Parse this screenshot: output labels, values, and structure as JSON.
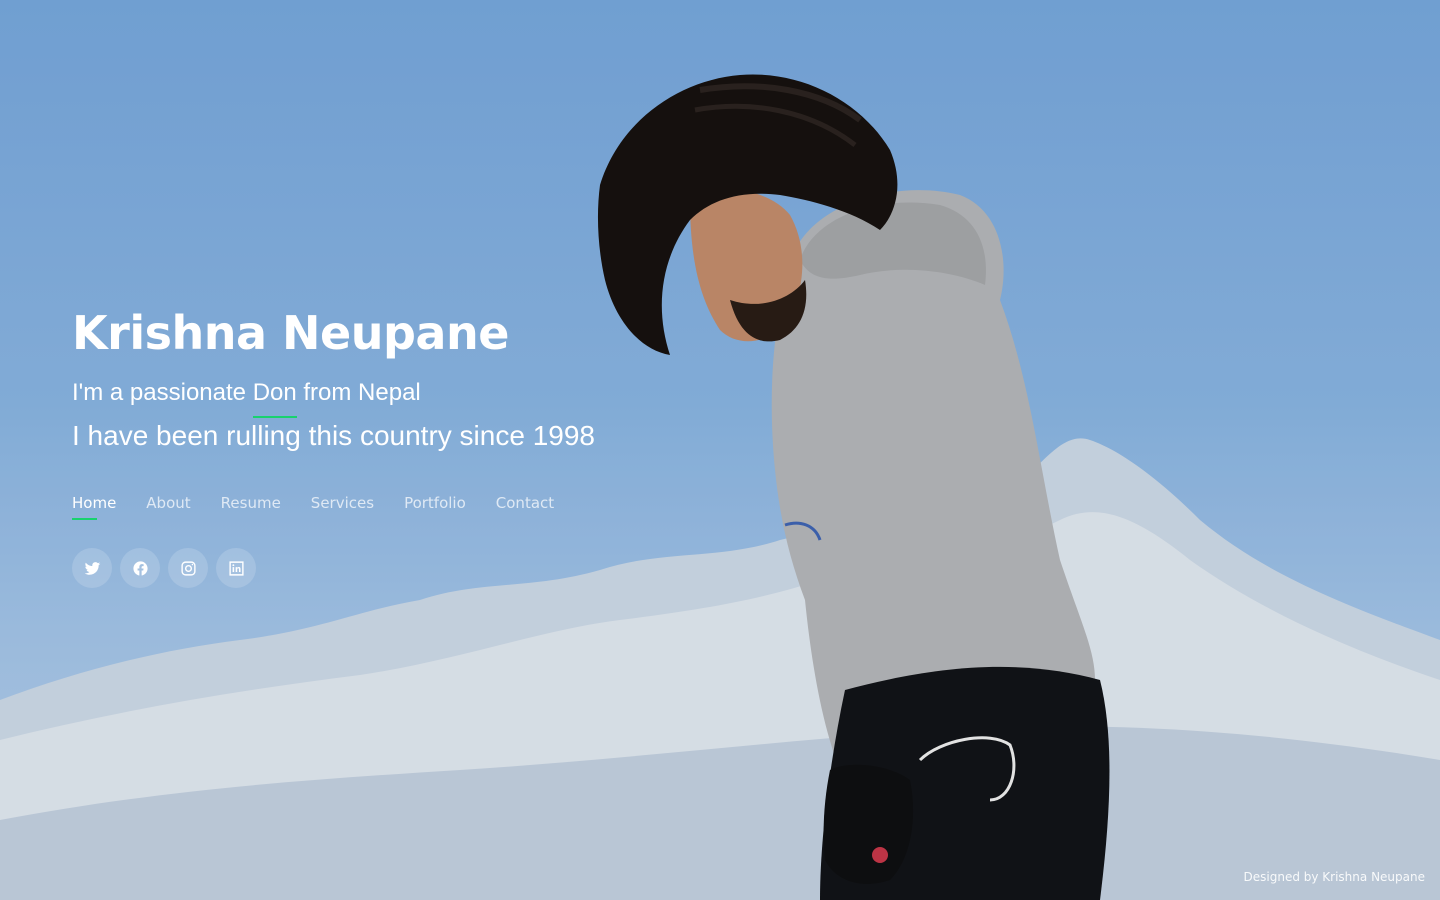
{
  "hero": {
    "name": "Krishna Neupane",
    "tagline": {
      "prefix": "I'm a passionate",
      "highlight": "Don",
      "suffix": "from Nepal"
    },
    "tagline_line2": "I have been rulling this country since 1998"
  },
  "nav": {
    "items": [
      {
        "label": "Home",
        "active": true
      },
      {
        "label": "About",
        "active": false
      },
      {
        "label": "Resume",
        "active": false
      },
      {
        "label": "Services",
        "active": false
      },
      {
        "label": "Portfolio",
        "active": false
      },
      {
        "label": "Contact",
        "active": false
      }
    ]
  },
  "social": [
    {
      "icon": "twitter-icon"
    },
    {
      "icon": "facebook-icon"
    },
    {
      "icon": "instagram-icon"
    },
    {
      "icon": "linkedin-icon"
    }
  ],
  "footer": {
    "credit": "Designed by Krishna Neupane"
  },
  "colors": {
    "accent": "#18d26e",
    "sky_top": "#78a9df",
    "sky_bottom": "#b9d2ee",
    "hoodie": "#b6b8bb",
    "pants": "#121418",
    "hair": "#17120f"
  }
}
